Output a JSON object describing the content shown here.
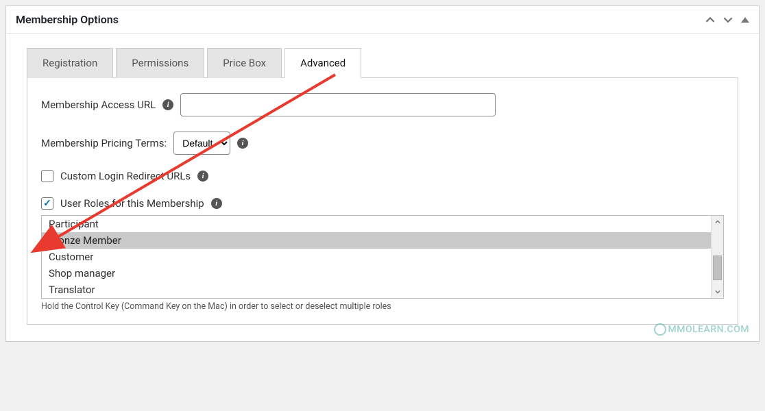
{
  "panel": {
    "title": "Membership Options"
  },
  "tabs": [
    {
      "label": "Registration",
      "active": false
    },
    {
      "label": "Permissions",
      "active": false
    },
    {
      "label": "Price Box",
      "active": false
    },
    {
      "label": "Advanced",
      "active": true
    }
  ],
  "fields": {
    "access_url_label": "Membership Access URL",
    "access_url_value": "",
    "pricing_terms_label": "Membership Pricing Terms:",
    "pricing_terms_value": "Default",
    "custom_login_label": "Custom Login Redirect URLs",
    "custom_login_checked": false,
    "user_roles_label": "User Roles for this Membership",
    "user_roles_checked": true
  },
  "roles": [
    {
      "label": "Participant",
      "selected": false
    },
    {
      "label": "Bronze Member",
      "selected": true
    },
    {
      "label": "Customer",
      "selected": false
    },
    {
      "label": "Shop manager",
      "selected": false
    },
    {
      "label": "Translator",
      "selected": false
    }
  ],
  "helper_text": "Hold the Control Key (Command Key on the Mac) in order to select or deselect multiple roles",
  "watermark": "MMOLEARN.COM"
}
